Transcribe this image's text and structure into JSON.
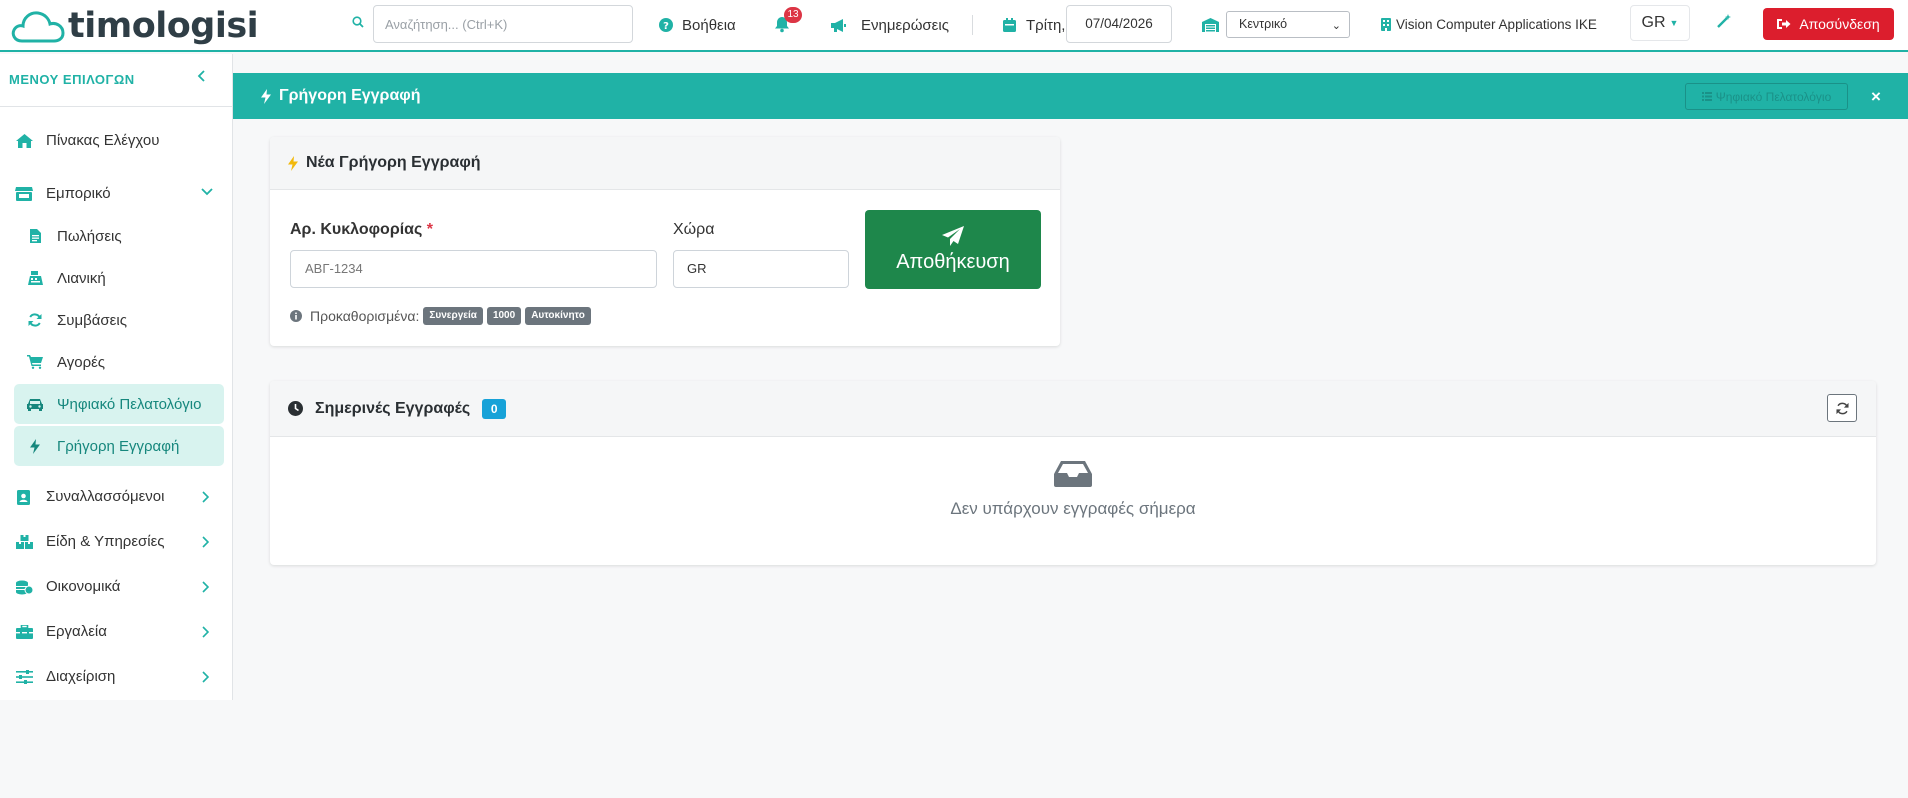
{
  "header": {
    "brand": "timologisi",
    "search_placeholder": "Αναζήτηση... (Ctrl+K)",
    "help_label": "Βοήθεια",
    "notifications_count": "13",
    "updates_label": "Ενημερώσεις",
    "day_label": "Τρίτη,",
    "date_value": "07/04/2026",
    "branch_value": "Κεντρικό",
    "company_name": "Vision Computer Applications IKE",
    "language": "GR",
    "logout_label": "Αποσύνδεση"
  },
  "sidebar": {
    "title": "ΜΕΝΟΥ ΕΠΙΛΟΓΩΝ",
    "dashboard": "Πίνακας Ελέγχου",
    "commercial": "Εμπορικό",
    "sub_items": [
      {
        "label": "Πωλήσεις",
        "icon": "file-invoice-icon"
      },
      {
        "label": "Λιανική",
        "icon": "cash-register-icon"
      },
      {
        "label": "Συμβάσεις",
        "icon": "sync-icon"
      },
      {
        "label": "Αγορές",
        "icon": "cart-icon"
      },
      {
        "label": "Ψηφιακό Πελατολόγιο",
        "icon": "car-icon"
      },
      {
        "label": "Γρήγορη Εγγραφή",
        "icon": "bolt-icon"
      }
    ],
    "items": [
      {
        "label": "Συναλλασσόμενοι",
        "icon": "contact-icon"
      },
      {
        "label": "Είδη & Υπηρεσίες",
        "icon": "boxes-icon"
      },
      {
        "label": "Οικονομικά",
        "icon": "coins-icon"
      },
      {
        "label": "Εργαλεία",
        "icon": "toolbox-icon"
      },
      {
        "label": "Διαχείριση",
        "icon": "sliders-icon"
      }
    ]
  },
  "page": {
    "banner_title": "Γρήγορη Εγγραφή",
    "banner_button": "Ψηφιακό Πελατολόγιο",
    "close_symbol": "×"
  },
  "quick_entry": {
    "title": "Νέα Γρήγορη Εγγραφή",
    "plate_label": "Αρ. Κυκλοφορίας",
    "required_mark": "*",
    "plate_placeholder": "ΑΒΓ-1234",
    "country_label": "Χώρα",
    "country_value": "GR",
    "save_label": "Αποθήκευση",
    "presets_label": "Προκαθορισμένα:",
    "presets": [
      "Συνεργεία",
      "1000",
      "Αυτοκίνητο"
    ]
  },
  "today": {
    "title": "Σημερινές Εγγραφές",
    "count": "0",
    "empty_text": "Δεν υπάρχουν εγγραφές σήμερα"
  },
  "colors": {
    "accent": "#20b2a6",
    "danger": "#dc1e2d",
    "success": "#1e874b",
    "info": "#17a2d8",
    "active_bg": "#d8f3ef"
  }
}
